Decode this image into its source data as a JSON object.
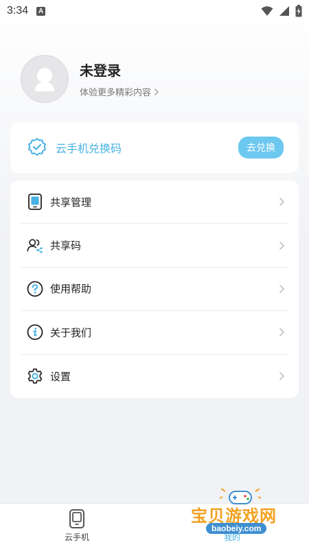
{
  "status_bar": {
    "time": "3:34",
    "notification_letter": "A"
  },
  "profile": {
    "name": "未登录",
    "subtitle": "体验更多精彩内容"
  },
  "redeem": {
    "label": "云手机兑换码",
    "button": "去兑换"
  },
  "menu": {
    "items": [
      {
        "label": "共享管理",
        "icon": "tablet-icon"
      },
      {
        "label": "共享码",
        "icon": "users-share-icon"
      },
      {
        "label": "使用帮助",
        "icon": "help-circle-icon"
      },
      {
        "label": "关于我们",
        "icon": "info-circle-icon"
      },
      {
        "label": "设置",
        "icon": "gear-icon"
      }
    ]
  },
  "bottom_nav": {
    "items": [
      {
        "label": "云手机",
        "icon": "phone-icon",
        "active": false
      },
      {
        "label": "我的",
        "icon": "user-icon",
        "active": true
      }
    ]
  },
  "watermark": {
    "title": "宝贝游戏网",
    "url": "baobeiy.com"
  },
  "colors": {
    "accent": "#47b2e6",
    "button": "#6dc8ef",
    "background": "#f1f2f6"
  }
}
